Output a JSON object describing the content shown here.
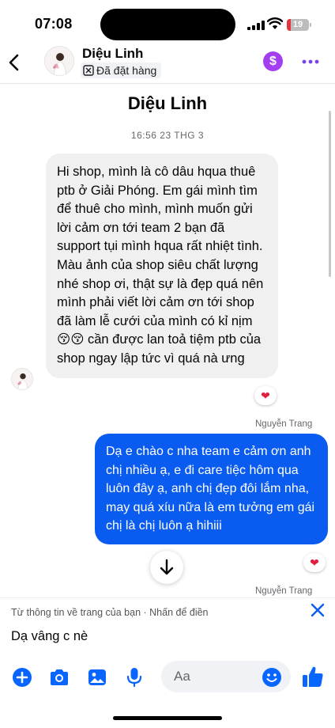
{
  "status_bar": {
    "time": "07:08",
    "battery": "19",
    "battery_level": 0.19
  },
  "header": {
    "contact_name": "Diệu Linh",
    "order_status": "Đã đặt hàng"
  },
  "conversation": {
    "title": "Diệu Linh",
    "timestamp": "16:56 23 THG 3",
    "messages": [
      {
        "text": "Hi shop, mình là cô dâu hqua thuê ptb ở Giải Phóng. Em gái mình tìm để thuê cho mình, mình muốn gửi lời cảm ơn tới team 2 bạn đã support tụi mình hqua rất nhiệt tình. Màu ảnh của shop siêu chất lượng nhé shop ơi, thật sự là đẹp quá nên mình phải viết lời cảm ơn tới shop đã làm lễ cưới của mình có kỉ nịm 😚😚 cần được lan toả tiệm ptb của shop ngay lập tức vì quá nà ưng",
        "reaction": "❤"
      },
      {
        "sender": "Nguyễn Trang",
        "text": "Dạ e chào c nha team e cảm ơn anh chị nhiều ạ, e đi care tiệc hôm qua luôn đây ạ, anh chị đẹp đôi lắm nha, may quá xíu nữa là em tưởng em gái chị là chị luôn ạ hihiii",
        "reaction": "❤"
      }
    ],
    "trailing_sender": "Nguyễn Trang"
  },
  "autofill": {
    "hint": "Từ thông tin về trang của bạn · Nhấn để điền",
    "text": "Dạ vâng c nè"
  },
  "composer": {
    "placeholder": "Aa"
  },
  "colors": {
    "accent_blue": "#0a5cf0",
    "messenger_blue": "#0866ff",
    "dollar_purple": "#a33ff0",
    "heart_red": "#e41e3f"
  }
}
